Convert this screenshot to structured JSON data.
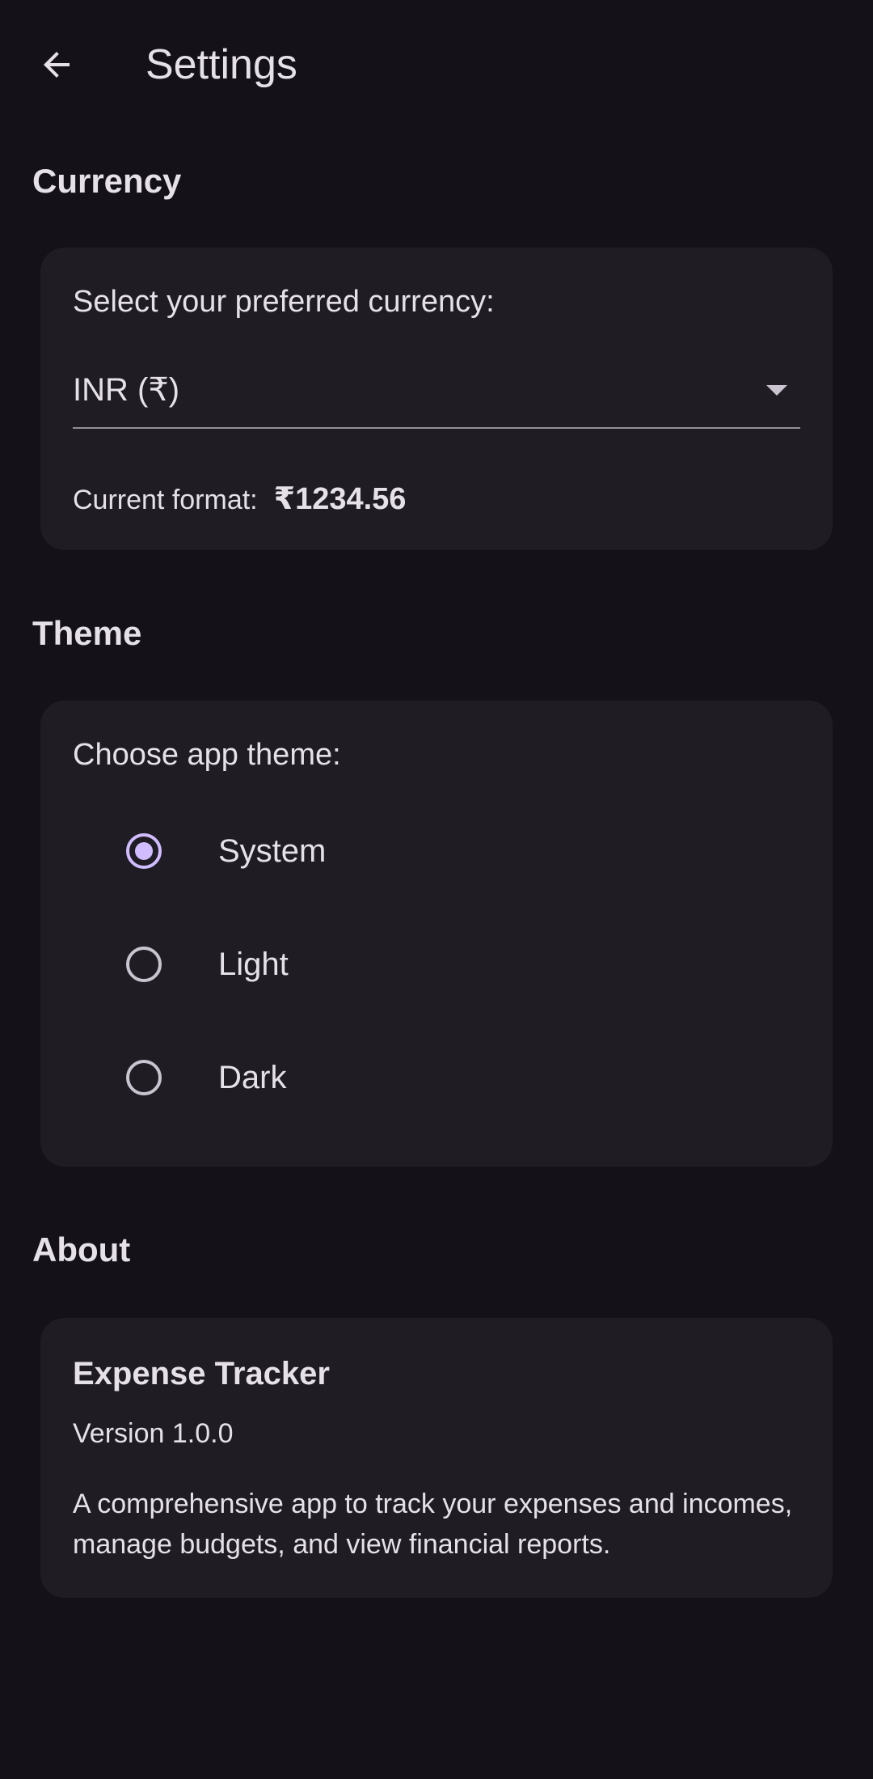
{
  "header": {
    "title": "Settings"
  },
  "currency": {
    "section_title": "Currency",
    "prompt": "Select your preferred currency:",
    "selected": "INR (₹)",
    "format_label": "Current format:",
    "format_value": "₹1234.56"
  },
  "theme": {
    "section_title": "Theme",
    "prompt": "Choose app theme:",
    "options": [
      {
        "label": "System",
        "selected": true
      },
      {
        "label": "Light",
        "selected": false
      },
      {
        "label": "Dark",
        "selected": false
      }
    ]
  },
  "about": {
    "section_title": "About",
    "app_name": "Expense Tracker",
    "version": "Version 1.0.0",
    "description": "A comprehensive app to track your expenses and incomes, manage budgets, and view financial reports."
  },
  "colors": {
    "background": "#141218",
    "card": "#1F1D23",
    "accent": "#D0BCFF",
    "text": "#E6E0E9"
  },
  "icons": {
    "back": "arrow-back-icon",
    "dropdown": "arrow-drop-down-icon"
  }
}
